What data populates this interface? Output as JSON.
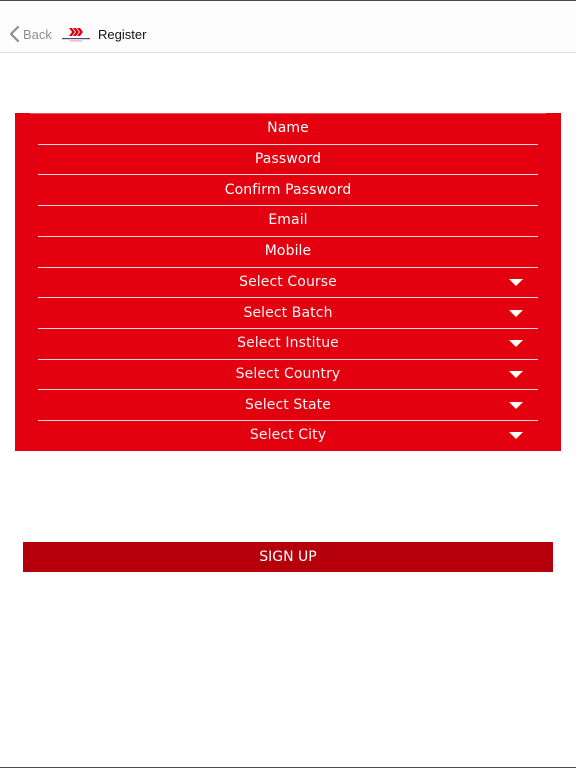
{
  "navbar": {
    "back_label": "Back",
    "title": "Register",
    "logo_icon": "brand-logo-chevrons-icon"
  },
  "form": {
    "rows": [
      {
        "label": "Name",
        "type": "input",
        "icon": null
      },
      {
        "label": "Password",
        "type": "input",
        "icon": null
      },
      {
        "label": "Confirm Password",
        "type": "input",
        "icon": null
      },
      {
        "label": "Email",
        "type": "input",
        "icon": null
      },
      {
        "label": "Mobile",
        "type": "input",
        "icon": null
      },
      {
        "label": "Select Course",
        "type": "select",
        "icon": "dropdown-arrow-icon"
      },
      {
        "label": "Select Batch",
        "type": "select",
        "icon": "dropdown-arrow-icon"
      },
      {
        "label": "Select Institue",
        "type": "select",
        "icon": "dropdown-arrow-icon"
      },
      {
        "label": "Select Country",
        "type": "select",
        "icon": "dropdown-arrow-icon"
      },
      {
        "label": "Select State",
        "type": "select",
        "icon": "dropdown-arrow-icon"
      },
      {
        "label": "Select City",
        "type": "select",
        "icon": "dropdown-arrow-icon"
      }
    ]
  },
  "signup": {
    "label": "SIGN UP"
  },
  "colors": {
    "panel_red": "#e3000f",
    "button_red": "#b5000b",
    "nav_back_gray": "#8e8e93",
    "text_white": "#ffffff"
  }
}
